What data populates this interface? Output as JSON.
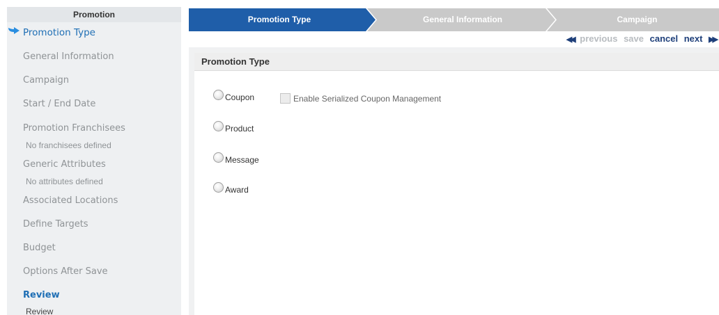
{
  "sidebar": {
    "title": "Promotion",
    "items": [
      {
        "label": "Promotion Type"
      },
      {
        "label": "General Information"
      },
      {
        "label": "Campaign"
      },
      {
        "label": "Start / End Date"
      },
      {
        "label": "Promotion Franchisees"
      },
      {
        "label": "No franchisees defined"
      },
      {
        "label": "Generic Attributes"
      },
      {
        "label": "No attributes defined"
      },
      {
        "label": "Associated Locations"
      },
      {
        "label": "Define Targets"
      },
      {
        "label": "Budget"
      },
      {
        "label": "Options After Save"
      },
      {
        "label": "Review"
      },
      {
        "label": "Review"
      }
    ],
    "current_icon": "arrow-right-icon"
  },
  "steps": {
    "step1": "Promotion Type",
    "step2": "General Information",
    "step3": "Campaign",
    "active_color": "#1f5ea9",
    "inactive_color": "#c9c9c9"
  },
  "nav": {
    "previous": "previous",
    "save": "save",
    "cancel": "cancel",
    "next": "next",
    "prev_icon": "double-left-arrow-icon",
    "next_icon": "double-right-arrow-icon"
  },
  "content": {
    "section_title": "Promotion Type",
    "options": [
      {
        "label": "Coupon"
      },
      {
        "label": "Product"
      },
      {
        "label": "Message"
      },
      {
        "label": "Award"
      }
    ],
    "checkbox_label": "Enable Serialized Coupon Management"
  }
}
